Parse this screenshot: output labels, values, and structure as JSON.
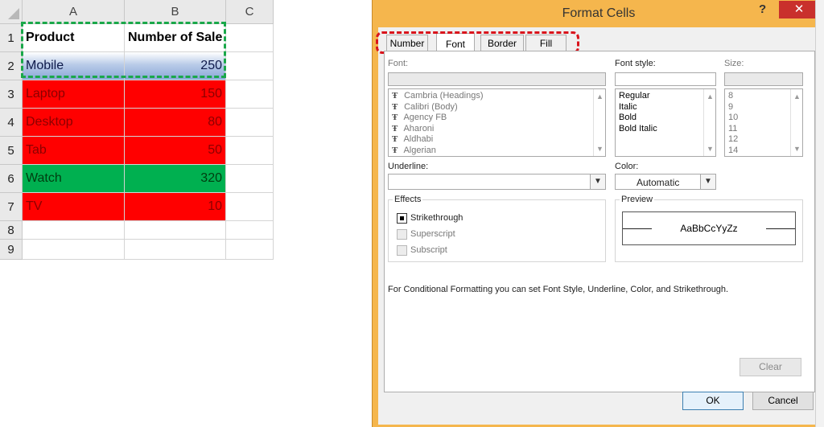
{
  "sheet": {
    "columns": [
      "A",
      "B",
      "C"
    ],
    "rows": [
      {
        "num": "1",
        "a": "Product",
        "b": "Number of Sale",
        "style": "header"
      },
      {
        "num": "2",
        "a": "Mobile",
        "b": "250",
        "style": "gradient"
      },
      {
        "num": "3",
        "a": "Laptop",
        "b": "150",
        "style": "red"
      },
      {
        "num": "4",
        "a": "Desktop",
        "b": "80",
        "style": "red"
      },
      {
        "num": "5",
        "a": "Tab",
        "b": "50",
        "style": "red"
      },
      {
        "num": "6",
        "a": "Watch",
        "b": "320",
        "style": "green"
      },
      {
        "num": "7",
        "a": "TV",
        "b": "10",
        "style": "red"
      },
      {
        "num": "8",
        "a": "",
        "b": "",
        "style": "empty"
      },
      {
        "num": "9",
        "a": "",
        "b": "",
        "style": "empty"
      }
    ]
  },
  "dialog": {
    "title": "Format Cells",
    "help": "?",
    "close": "✕",
    "tabs": [
      "Number",
      "Font",
      "Border",
      "Fill"
    ],
    "active_tab": "Font",
    "font_label": "Font:",
    "fonts": [
      "Cambria (Headings)",
      "Calibri (Body)",
      "Agency FB",
      "Aharoni",
      "Aldhabi",
      "Algerian"
    ],
    "style_label": "Font style:",
    "styles": [
      "Regular",
      "Italic",
      "Bold",
      "Bold Italic"
    ],
    "size_label": "Size:",
    "sizes": [
      "8",
      "9",
      "10",
      "11",
      "12",
      "14"
    ],
    "underline_label": "Underline:",
    "underline_value": "",
    "color_label": "Color:",
    "color_value": "Automatic",
    "effects_label": "Effects",
    "strikethrough": "Strikethrough",
    "superscript": "Superscript",
    "subscript": "Subscript",
    "preview_label": "Preview",
    "preview_text": "AaBbCcYyZz",
    "note": "For Conditional Formatting you can set Font Style, Underline, Color, and Strikethrough.",
    "clear": "Clear",
    "ok": "OK",
    "cancel": "Cancel"
  },
  "colors": {
    "red_fill": "#ff0000",
    "green_fill": "#00b050",
    "dialog_frame": "#f5b64d",
    "selection_green": "#1aa84a",
    "highlight_red": "#d9141c"
  }
}
